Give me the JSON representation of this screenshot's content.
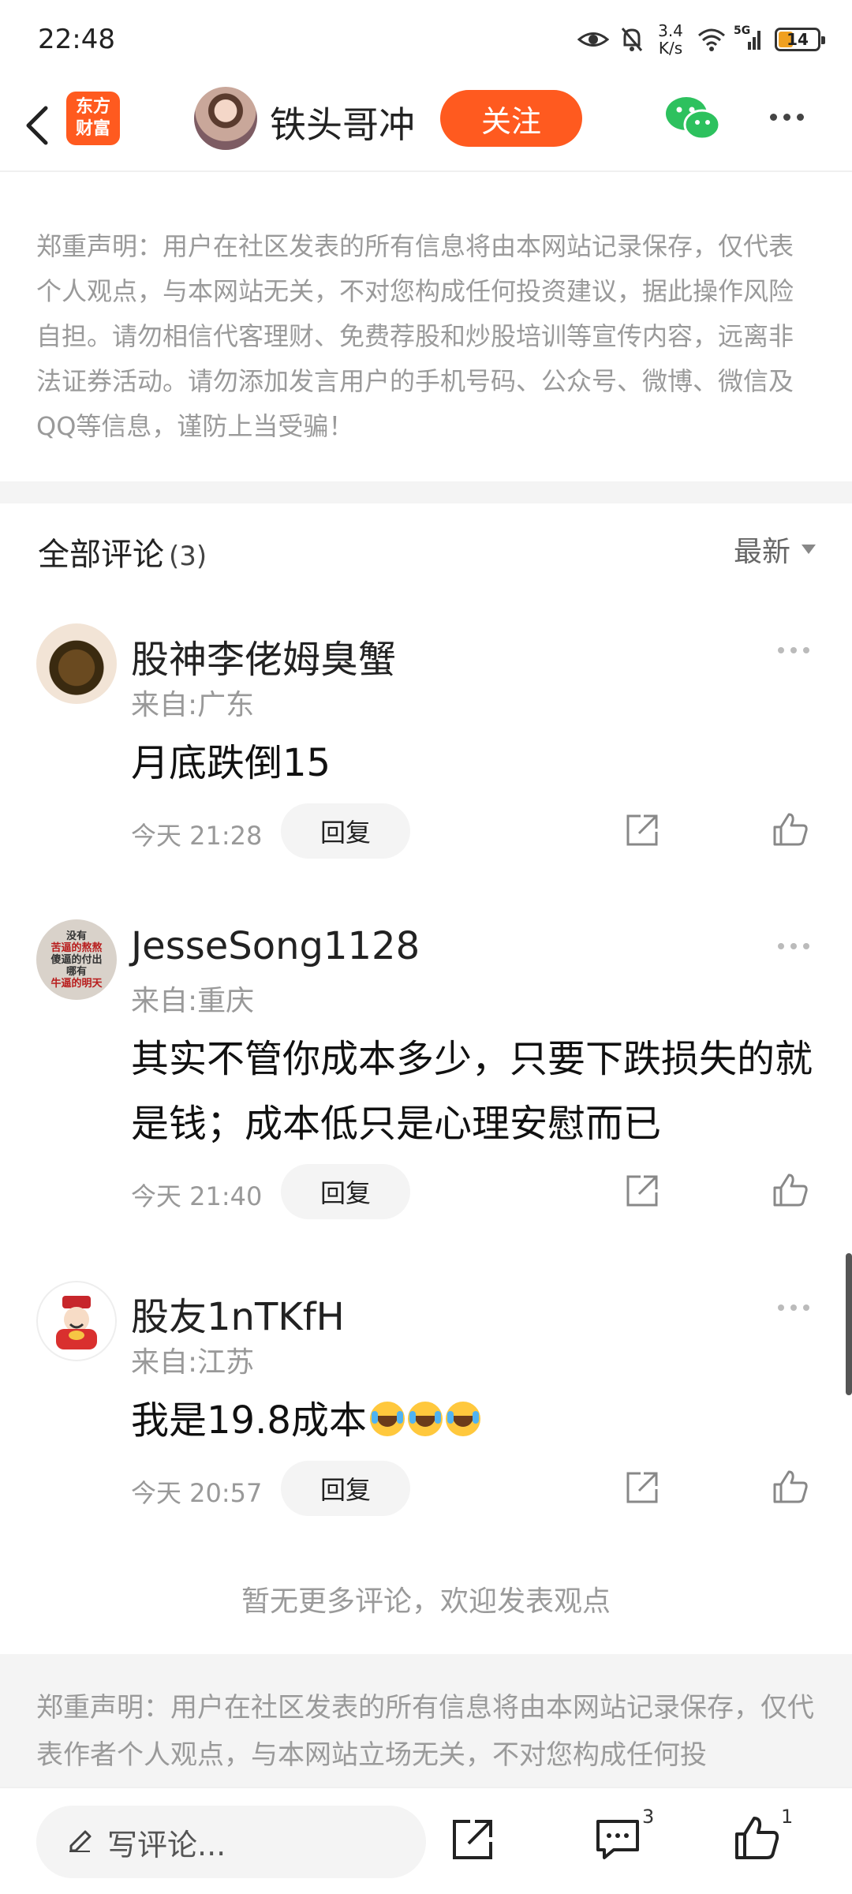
{
  "status_bar": {
    "time": "22:48",
    "net_speed_value": "3.4",
    "net_speed_unit": "K/s",
    "network_type": "5G",
    "battery": "14"
  },
  "header": {
    "logo_line1": "东方",
    "logo_line2": "财富",
    "username": "铁头哥冲",
    "follow_label": "关注"
  },
  "disclaimer_top": "郑重声明：用户在社区发表的所有信息将由本网站记录保存，仅代表个人观点，与本网站无关，不对您构成任何投资建议，据此操作风险自担。请勿相信代客理财、免费荐股和炒股培训等宣传内容，远离非法证券活动。请勿添加发言用户的手机号码、公众号、微博、微信及QQ等信息，谨防上当受骗！",
  "comments_section": {
    "title": "全部评论",
    "count": "(3)",
    "sort_label": "最新"
  },
  "comments": [
    {
      "name": "股神李佬姆臭蟹",
      "location": "来自:广东",
      "text": "月底跌倒15",
      "time": "今天 21:28",
      "reply_label": "回复"
    },
    {
      "name": "JesseSong1128",
      "location": "来自:重庆",
      "text": "其实不管你成本多少，只要下跌损失的就是钱；成本低只是心理安慰而已",
      "time": "今天 21:40",
      "reply_label": "回复",
      "avatar_text": [
        "没有",
        "苦逼的熬熬",
        "傻逼的付出",
        "哪有",
        "牛逼的明天"
      ]
    },
    {
      "name": "股友1nTKfH",
      "location": "来自:江苏",
      "text": "我是19.8成本",
      "time": "今天 20:57",
      "reply_label": "回复"
    }
  ],
  "no_more_text": "暂无更多评论，欢迎发表观点",
  "disclaimer_bottom": "郑重声明：用户在社区发表的所有信息将由本网站记录保存，仅代表作者个人观点，与本网站立场无关，不对您构成任何投",
  "bottom_bar": {
    "comment_placeholder": "写评论...",
    "comment_count": "3",
    "like_count": "1"
  }
}
